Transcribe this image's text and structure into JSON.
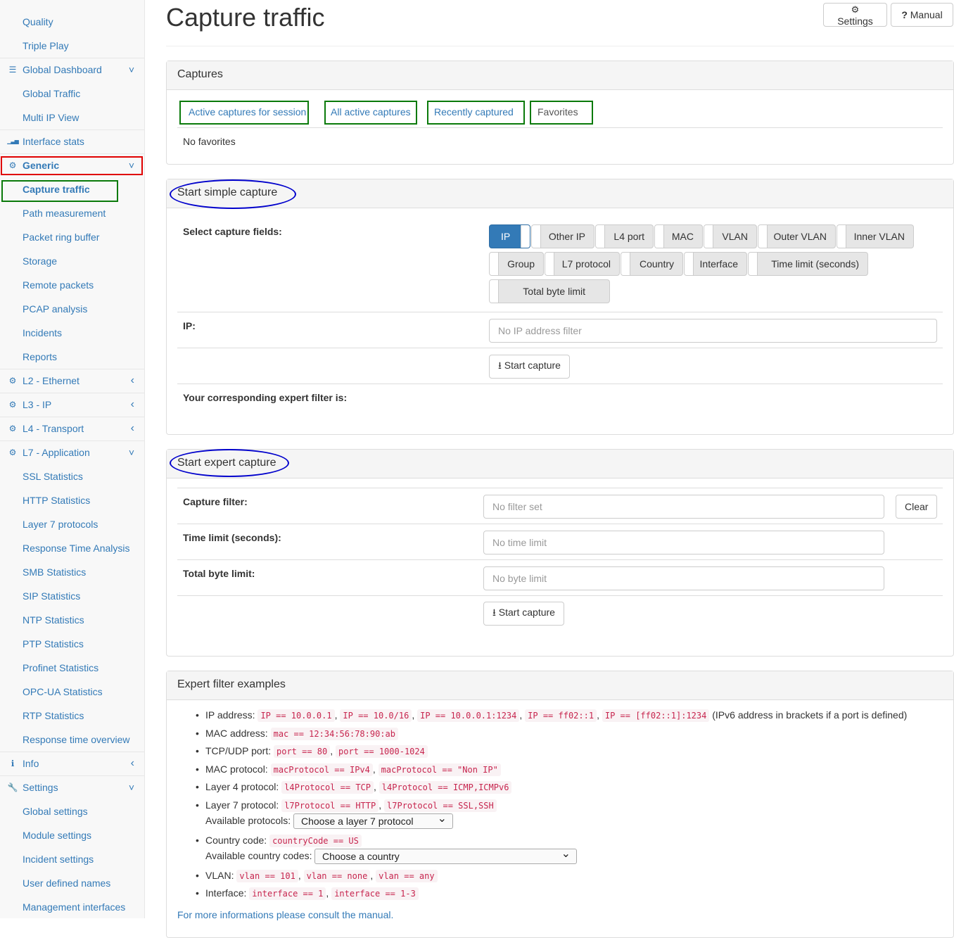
{
  "sidebar": {
    "items": [
      {
        "label": "Quality",
        "icon": "",
        "caret": ""
      },
      {
        "label": "Triple Play",
        "icon": "",
        "caret": ""
      },
      {
        "label": "Global Dashboard",
        "icon": "dashboard-icon",
        "caret": "chevron-down-icon"
      },
      {
        "label": "Global Traffic",
        "icon": "",
        "caret": ""
      },
      {
        "label": "Multi IP View",
        "icon": "",
        "caret": ""
      },
      {
        "label": "Interface stats",
        "icon": "bar-chart-icon",
        "caret": ""
      },
      {
        "label": "Generic",
        "icon": "gear-icon",
        "caret": "chevron-down-icon"
      },
      {
        "label": "Capture traffic",
        "icon": "",
        "caret": ""
      },
      {
        "label": "Path measurement",
        "icon": "",
        "caret": ""
      },
      {
        "label": "Packet ring buffer",
        "icon": "",
        "caret": ""
      },
      {
        "label": "Storage",
        "icon": "",
        "caret": ""
      },
      {
        "label": "Remote packets",
        "icon": "",
        "caret": ""
      },
      {
        "label": "PCAP analysis",
        "icon": "",
        "caret": ""
      },
      {
        "label": "Incidents",
        "icon": "",
        "caret": ""
      },
      {
        "label": "Reports",
        "icon": "",
        "caret": ""
      },
      {
        "label": "L2 - Ethernet",
        "icon": "gear-icon",
        "caret": "chevron-left-icon"
      },
      {
        "label": "L3 - IP",
        "icon": "gear-icon",
        "caret": "chevron-left-icon"
      },
      {
        "label": "L4 - Transport",
        "icon": "gear-icon",
        "caret": "chevron-left-icon"
      },
      {
        "label": "L7 - Application",
        "icon": "gear-icon",
        "caret": "chevron-down-icon"
      },
      {
        "label": "SSL Statistics",
        "icon": "",
        "caret": ""
      },
      {
        "label": "HTTP Statistics",
        "icon": "",
        "caret": ""
      },
      {
        "label": "Layer 7 protocols",
        "icon": "",
        "caret": ""
      },
      {
        "label": "Response Time Analysis",
        "icon": "",
        "caret": ""
      },
      {
        "label": "SMB Statistics",
        "icon": "",
        "caret": ""
      },
      {
        "label": "SIP Statistics",
        "icon": "",
        "caret": ""
      },
      {
        "label": "NTP Statistics",
        "icon": "",
        "caret": ""
      },
      {
        "label": "PTP Statistics",
        "icon": "",
        "caret": ""
      },
      {
        "label": "Profinet Statistics",
        "icon": "",
        "caret": ""
      },
      {
        "label": "OPC-UA Statistics",
        "icon": "",
        "caret": ""
      },
      {
        "label": "RTP Statistics",
        "icon": "",
        "caret": ""
      },
      {
        "label": "Response time overview",
        "icon": "",
        "caret": ""
      },
      {
        "label": "Info",
        "icon": "info-icon",
        "caret": "chevron-left-icon"
      },
      {
        "label": "Settings",
        "icon": "wrench-icon",
        "caret": "chevron-down-icon"
      },
      {
        "label": "Global settings",
        "icon": "",
        "caret": ""
      },
      {
        "label": "Module settings",
        "icon": "",
        "caret": ""
      },
      {
        "label": "Incident settings",
        "icon": "",
        "caret": ""
      },
      {
        "label": "User defined names",
        "icon": "",
        "caret": ""
      },
      {
        "label": "Management interfaces",
        "icon": "",
        "caret": ""
      }
    ]
  },
  "header": {
    "title": "Capture traffic",
    "settings_label": "Settings",
    "manual_label": "Manual"
  },
  "captures": {
    "title": "Captures",
    "tabs": [
      "Active captures for session",
      "All active captures",
      "Recently captured",
      "Favorites"
    ],
    "empty_text": "No favorites"
  },
  "simple": {
    "title": "Start simple capture",
    "fields_label": "Select capture fields:",
    "toggles": [
      "IP",
      "Other IP",
      "L4 port",
      "MAC",
      "VLAN",
      "Outer VLAN",
      "Inner VLAN",
      "Group",
      "L7 protocol",
      "Country",
      "Interface",
      "Time limit (seconds)",
      "Total byte limit"
    ],
    "ip_label": "IP:",
    "ip_placeholder": "No IP address filter",
    "start_label": "Start capture",
    "expert_filter_label": "Your corresponding expert filter is:"
  },
  "expert": {
    "title": "Start expert capture",
    "filter_label": "Capture filter:",
    "filter_placeholder": "No filter set",
    "clear_label": "Clear",
    "time_label": "Time limit (seconds):",
    "time_placeholder": "No time limit",
    "bytes_label": "Total byte limit:",
    "bytes_placeholder": "No byte limit",
    "start_label": "Start capture"
  },
  "examples": {
    "title": "Expert filter examples",
    "ip": {
      "label": "IP address:",
      "codes": [
        "IP == 10.0.0.1",
        "IP == 10.0/16",
        "IP == 10.0.0.1:1234",
        "IP == ff02::1",
        "IP == [ff02::1]:1234"
      ],
      "note": "(IPv6 address in brackets if a port is defined)"
    },
    "mac": {
      "label": "MAC address:",
      "codes": [
        "mac == 12:34:56:78:90:ab"
      ]
    },
    "port": {
      "label": "TCP/UDP port:",
      "codes": [
        "port == 80",
        "port == 1000-1024"
      ]
    },
    "macproto": {
      "label": "MAC protocol:",
      "codes": [
        "macProtocol == IPv4",
        "macProtocol == \"Non IP\""
      ]
    },
    "l4": {
      "label": "Layer 4 protocol:",
      "codes": [
        "l4Protocol == TCP",
        "l4Protocol == ICMP,ICMPv6"
      ]
    },
    "l7": {
      "label": "Layer 7 protocol:",
      "codes": [
        "l7Protocol == HTTP",
        "l7Protocol == SSL,SSH"
      ]
    },
    "l7_available_label": "Available protocols:",
    "l7_select": "Choose a layer 7 protocol",
    "country": {
      "label": "Country code:",
      "codes": [
        "countryCode == US"
      ]
    },
    "country_available_label": "Available country codes:",
    "country_select": "Choose a country",
    "vlan": {
      "label": "VLAN:",
      "codes": [
        "vlan == 101",
        "vlan == none",
        "vlan == any"
      ]
    },
    "iface": {
      "label": "Interface:",
      "codes": [
        "interface == 1",
        "interface == 1-3"
      ]
    },
    "more_info": "For more informations please consult the manual."
  },
  "colors": {
    "accent": "#337ab7",
    "annotation_red": "#e00000",
    "annotation_green": "#0a7a0a",
    "annotation_blue": "#0000cc"
  }
}
